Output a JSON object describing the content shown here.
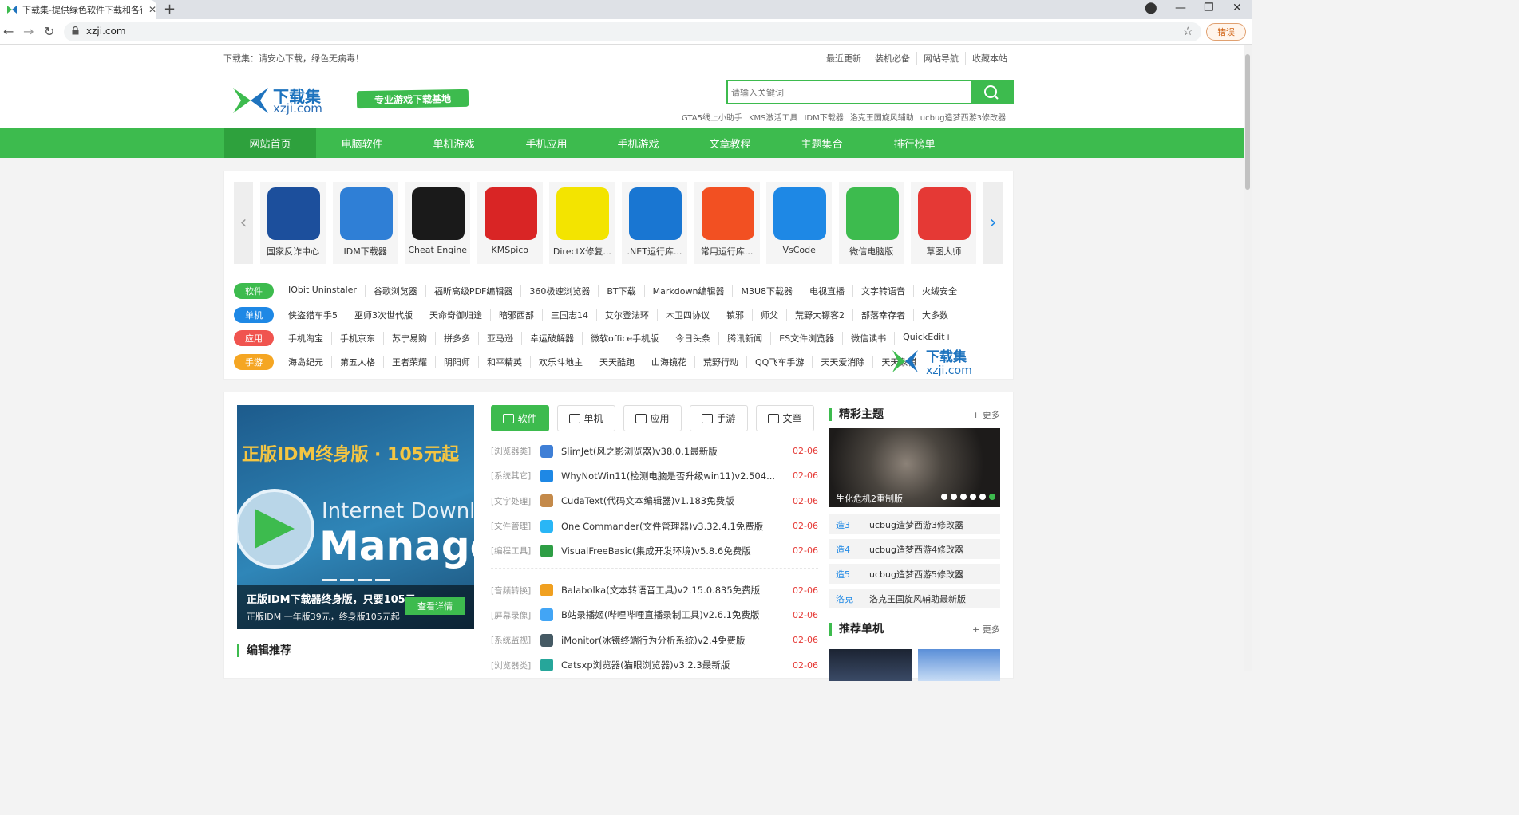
{
  "browser": {
    "tab_title": "下载集-提供绿色软件下载和各行",
    "url": "xzji.com",
    "error_label": "错误"
  },
  "site": {
    "slogan": "下载集：请安心下载，绿色无病毒！",
    "top_links": [
      "最近更新",
      "装机必备",
      "网站导航",
      "收藏本站"
    ],
    "logo_cn": "下载集",
    "logo_en": "xzji.com",
    "tagline": "专业游戏下载基地",
    "search_placeholder": "请输入关键词",
    "hot_words": [
      "GTA5线上小助手",
      "KMS激活工具",
      "IDM下载器",
      "洛克王国旋风辅助",
      "ucbug造梦西游3修改器"
    ],
    "nav": [
      "网站首页",
      "电脑软件",
      "单机游戏",
      "手机应用",
      "手机游戏",
      "文章教程",
      "主题集合",
      "排行榜单"
    ]
  },
  "carousel": {
    "apps": [
      {
        "label": "国家反诈中心",
        "color": "#1c4f9c"
      },
      {
        "label": "IDM下载器",
        "color": "#2f7fd6"
      },
      {
        "label": "Cheat Engine",
        "color": "#1a1a1a"
      },
      {
        "label": "KMSpico",
        "color": "#d92525"
      },
      {
        "label": "DirectX修复...",
        "color": "#f3e400"
      },
      {
        "label": ".NET运行库...",
        "color": "#1976d2"
      },
      {
        "label": "常用运行库...",
        "color": "#f25022"
      },
      {
        "label": "VsCode",
        "color": "#1e88e5"
      },
      {
        "label": "微信电脑版",
        "color": "#3dbb4e"
      },
      {
        "label": "草图大师",
        "color": "#e53935"
      }
    ]
  },
  "categories": [
    {
      "badge": "软件",
      "color": "#3dbb4e",
      "links": [
        "IObit Uninstaler",
        "谷歌浏览器",
        "福昕高级PDF编辑器",
        "360极速浏览器",
        "BT下载",
        "Markdown编辑器",
        "M3U8下载器",
        "电视直播",
        "文字转语音",
        "火绒安全"
      ]
    },
    {
      "badge": "单机",
      "color": "#1e88e5",
      "links": [
        "侠盗猎车手5",
        "巫师3次世代版",
        "天命奇御归途",
        "暗邪西部",
        "三国志14",
        "艾尔登法环",
        "木卫四协议",
        "镇邪",
        "师父",
        "荒野大镖客2",
        "部落幸存者",
        "大多数"
      ]
    },
    {
      "badge": "应用",
      "color": "#f0544f",
      "links": [
        "手机淘宝",
        "手机京东",
        "苏宁易购",
        "拼多多",
        "亚马逊",
        "幸运破解器",
        "微软office手机版",
        "今日头条",
        "腾讯新闻",
        "ES文件浏览器",
        "微信读书",
        "QuickEdit+"
      ]
    },
    {
      "badge": "手游",
      "color": "#f5a623",
      "links": [
        "海岛纪元",
        "第五人格",
        "王者荣耀",
        "阴阳师",
        "和平精英",
        "欢乐斗地主",
        "天天酷跑",
        "山海镜花",
        "荒野行动",
        "QQ飞车手游",
        "天天爱消除",
        "天天象棋"
      ]
    }
  ],
  "watermark": {
    "cn": "下载集",
    "en": "xzji.com"
  },
  "banner": {
    "headline": "正版IDM终身版 · 105元起",
    "line1": "Internet Downlo",
    "line2": "Manage",
    "caption_title": "正版IDM下载器终身版，只要105元",
    "caption_sub": "正版IDM 一年版39元，终身版105元起",
    "detail_label": "查看详情"
  },
  "editor_title": "编辑推荐",
  "tabs": [
    "软件",
    "单机",
    "应用",
    "手游",
    "文章"
  ],
  "list_a": [
    {
      "cat": "[浏览器类]",
      "name": "SlimJet(风之影浏览器)v38.0.1最新版",
      "date": "02-06",
      "color": "#3f7fd6"
    },
    {
      "cat": "[系统其它]",
      "name": "WhyNotWin11(检测电脑是否升级win11)v2.504...",
      "date": "02-06",
      "color": "#1e88e5"
    },
    {
      "cat": "[文字处理]",
      "name": "CudaText(代码文本编辑器)v1.183免费版",
      "date": "02-06",
      "color": "#c48a4a"
    },
    {
      "cat": "[文件管理]",
      "name": "One Commander(文件管理器)v3.32.4.1免费版",
      "date": "02-06",
      "color": "#29b6f6"
    },
    {
      "cat": "[编程工具]",
      "name": "VisualFreeBasic(集成开发环境)v5.8.6免费版",
      "date": "02-06",
      "color": "#2e9e45"
    }
  ],
  "list_b": [
    {
      "cat": "[音频转换]",
      "name": "Balabolka(文本转语音工具)v2.15.0.835免费版",
      "date": "02-06",
      "color": "#f0a020"
    },
    {
      "cat": "[屏幕录像]",
      "name": "B站录播姬(哔哩哔哩直播录制工具)v2.6.1免费版",
      "date": "02-06",
      "color": "#42a5f5"
    },
    {
      "cat": "[系统监视]",
      "name": "iMonitor(冰镜终端行为分析系统)v2.4免费版",
      "date": "02-06",
      "color": "#455a64"
    },
    {
      "cat": "[浏览器类]",
      "name": "Catsxp浏览器(猫眼浏览器)v3.2.3最新版",
      "date": "02-06",
      "color": "#26a69a"
    }
  ],
  "topics": {
    "title": "精彩主题",
    "more": "+ 更多",
    "feature_caption": "生化危机2重制版",
    "items": [
      {
        "tag": "造3",
        "name": "ucbug造梦西游3修改器"
      },
      {
        "tag": "造4",
        "name": "ucbug造梦西游4修改器"
      },
      {
        "tag": "造5",
        "name": "ucbug造梦西游5修改器"
      },
      {
        "tag": "洛克",
        "name": "洛克王国旋风辅助最新版"
      }
    ]
  },
  "recommend": {
    "title": "推荐单机",
    "more": "+ 更多"
  }
}
